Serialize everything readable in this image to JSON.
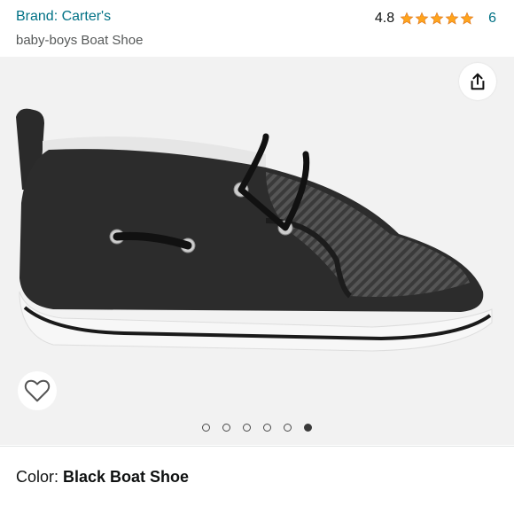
{
  "header": {
    "brand": "Brand: Carter's",
    "title": "baby-boys Boat Shoe",
    "rating_value": "4.8",
    "rating_count": "6",
    "stars": 5
  },
  "gallery": {
    "image_count": 6,
    "active_index": 5,
    "share_icon": "share-icon",
    "wishlist_icon": "heart-icon"
  },
  "color": {
    "label": "Color: ",
    "value": "Black Boat Shoe"
  },
  "colors": {
    "link": "#007185",
    "star": "#FFA41C",
    "text": "#0F1111"
  }
}
